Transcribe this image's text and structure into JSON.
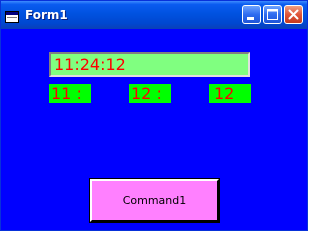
{
  "window": {
    "title": "Form1",
    "background_color": "#0000FF",
    "icon": "form-window-icon",
    "controls": {
      "minimize_icon": "minimize-icon",
      "maximize_icon": "maximize-icon",
      "close_icon": "close-icon"
    }
  },
  "clock": {
    "time_text": "11:24:12",
    "background_color": "#80FF80",
    "text_color": "#FF0000"
  },
  "parts": {
    "hours": "11 :",
    "minutes": "12 :",
    "seconds": "12",
    "background_color": "#00FF00",
    "text_color": "#FF0000"
  },
  "command_button": {
    "label": "Command1",
    "background_color": "#FF80FF"
  }
}
